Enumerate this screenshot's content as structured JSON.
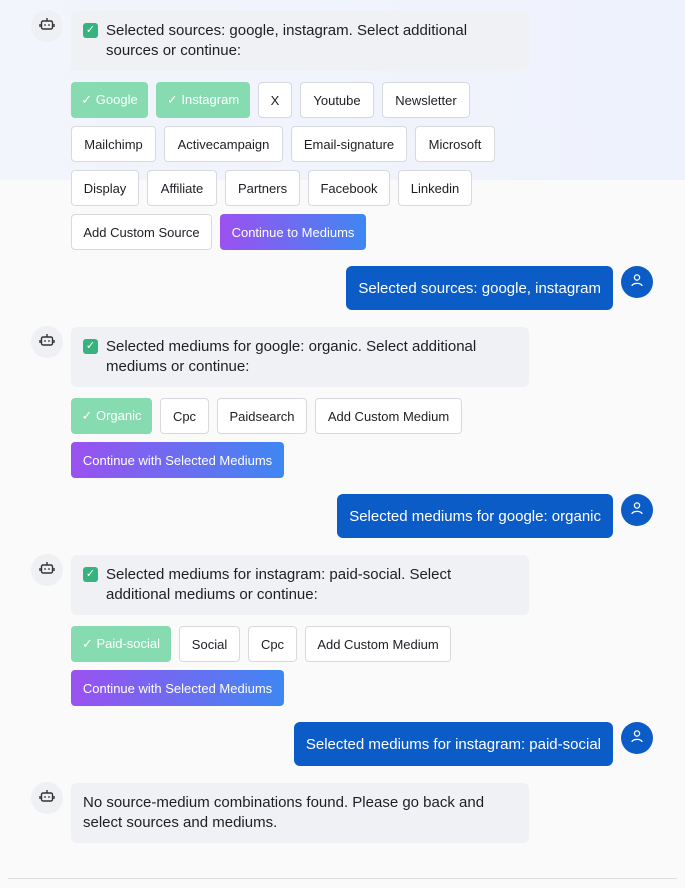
{
  "colors": {
    "user_bubble": "#0b5cc7",
    "selected_chip": "#86dbb1",
    "gradient_start": "#9b51f0",
    "gradient_end": "#3f87f2"
  },
  "messages": {
    "bot1": {
      "text": "Selected sources: google, instagram. Select additional sources or continue:",
      "chips": {
        "google": "✓ Google",
        "instagram": "✓ Instagram",
        "x": "X",
        "youtube": "Youtube",
        "newsletter": "Newsletter",
        "mailchimp": "Mailchimp",
        "activecampaign": "Activecampaign",
        "email_signature": "Email-signature",
        "microsoft": "Microsoft",
        "display": "Display",
        "affiliate": "Affiliate",
        "partners": "Partners",
        "facebook": "Facebook",
        "linkedin": "Linkedin",
        "add_custom": "Add Custom Source",
        "continue": "Continue to Mediums"
      }
    },
    "user1": {
      "text": "Selected sources: google, instagram"
    },
    "bot2": {
      "text": "Selected mediums for google: organic. Select additional mediums or continue:",
      "chips": {
        "organic": "✓ Organic",
        "cpc": "Cpc",
        "paidsearch": "Paidsearch",
        "add_custom": "Add Custom Medium",
        "continue": "Continue with Selected Mediums"
      }
    },
    "user2": {
      "text": "Selected mediums for google: organic"
    },
    "bot3": {
      "text": "Selected mediums for instagram: paid-social. Select additional mediums or continue:",
      "chips": {
        "paid_social": "✓ Paid-social",
        "social": "Social",
        "cpc": "Cpc",
        "add_custom": "Add Custom Medium",
        "continue": "Continue with Selected Mediums"
      }
    },
    "user3": {
      "text": "Selected mediums for instagram: paid-social"
    },
    "bot4": {
      "text": "No source-medium combinations found. Please go back and select sources and mediums."
    }
  }
}
